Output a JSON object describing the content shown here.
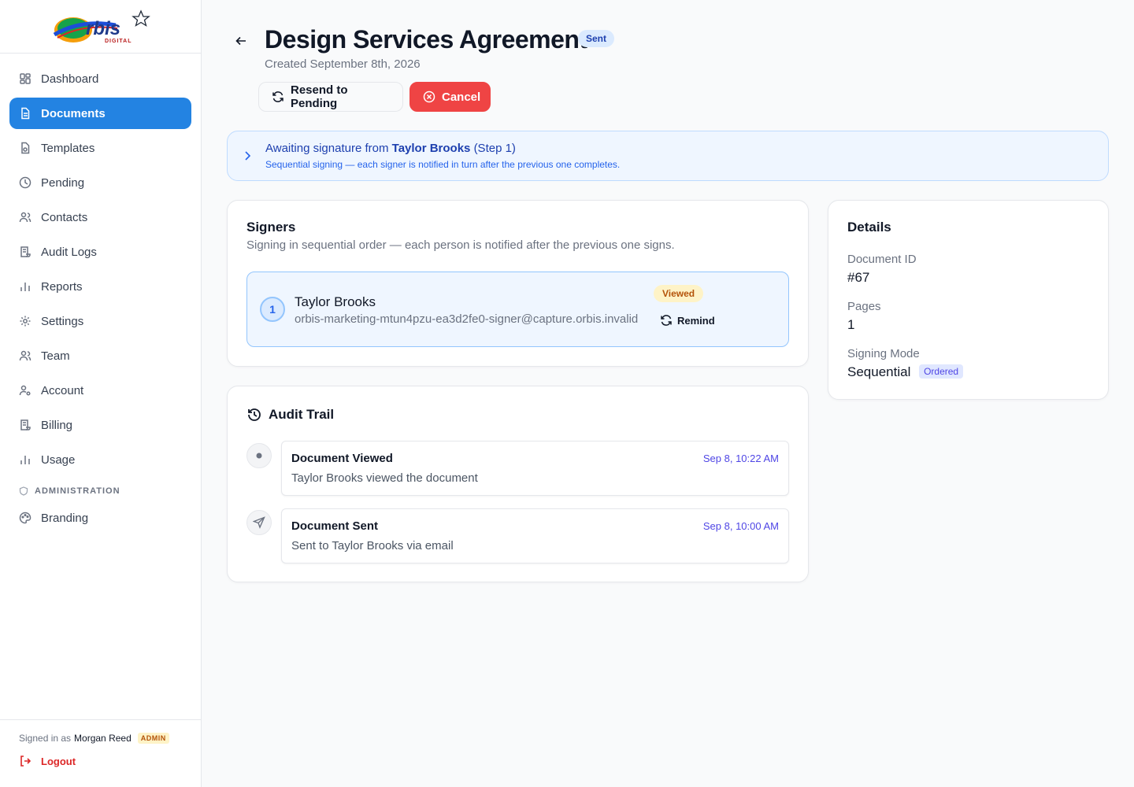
{
  "brand": {
    "logo_text": "rbis",
    "logo_sub": "DIGITAL",
    "colors": {
      "primary": "#2383e2",
      "danger": "#ef4444"
    }
  },
  "sidebar": {
    "items": [
      {
        "label": "Dashboard",
        "icon": "dashboard-icon"
      },
      {
        "label": "Documents",
        "icon": "document-icon",
        "active": true
      },
      {
        "label": "Templates",
        "icon": "template-icon"
      },
      {
        "label": "Pending",
        "icon": "clock-icon"
      },
      {
        "label": "Contacts",
        "icon": "contacts-icon"
      },
      {
        "label": "Audit Logs",
        "icon": "scroll-icon"
      },
      {
        "label": "Reports",
        "icon": "bar-chart-icon"
      },
      {
        "label": "Settings",
        "icon": "gear-icon"
      },
      {
        "label": "Team",
        "icon": "team-icon"
      },
      {
        "label": "Account",
        "icon": "user-settings-icon"
      },
      {
        "label": "Billing",
        "icon": "scroll-icon"
      },
      {
        "label": "Usage",
        "icon": "bar-chart-icon"
      }
    ],
    "admin_section_label": "ADMINISTRATION",
    "admin_items": [
      {
        "label": "Branding",
        "icon": "palette-icon"
      }
    ],
    "footer": {
      "signed_in_prefix": "Signed in as",
      "user_name": "Morgan Reed",
      "role_badge": "ADMIN",
      "logout_label": "Logout"
    }
  },
  "header": {
    "title": "Design Services Agreement",
    "status_badge": "Sent",
    "created": "Created September 8th, 2026",
    "resend_label": "Resend to Pending",
    "cancel_label": "Cancel"
  },
  "banner": {
    "prefix": "Awaiting signature from",
    "signer": "Taylor Brooks",
    "step": "(Step 1)",
    "subtitle": "Sequential signing — each signer is notified in turn after the previous one completes."
  },
  "signers": {
    "title": "Signers",
    "subtitle": "Signing in sequential order — each person is notified after the previous one signs.",
    "list": [
      {
        "order": "1",
        "name": "Taylor Brooks",
        "email": "orbis-marketing-mtun4pzu-ea3d2fe0-signer@capture.orbis.invalid",
        "status": "Viewed",
        "remind_label": "Remind"
      }
    ]
  },
  "audit": {
    "title": "Audit Trail",
    "events": [
      {
        "title": "Document Viewed",
        "time": "Sep 8, 10:22 AM",
        "description": "Taylor Brooks viewed the document",
        "icon": "dot-icon"
      },
      {
        "title": "Document Sent",
        "time": "Sep 8, 10:00 AM",
        "description": "Sent to Taylor Brooks via email",
        "icon": "send-icon"
      }
    ]
  },
  "details": {
    "title": "Details",
    "document_id_label": "Document ID",
    "document_id": "#67",
    "pages_label": "Pages",
    "pages": "1",
    "signing_mode_label": "Signing Mode",
    "signing_mode": "Sequential",
    "signing_mode_badge": "Ordered"
  }
}
